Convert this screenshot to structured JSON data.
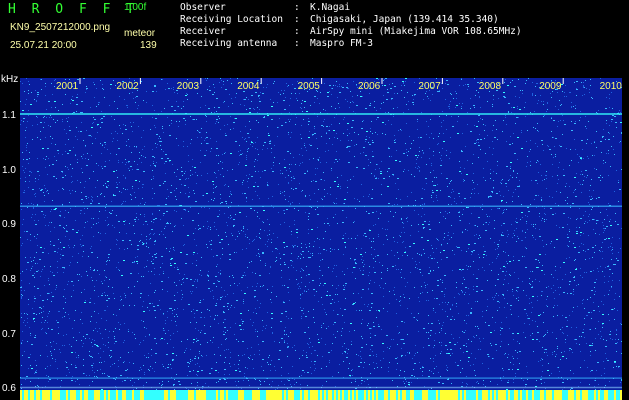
{
  "header": {
    "app_title": "H R O F F T",
    "version": "1.00f",
    "filename": "KN9_2507212000.png",
    "meteor_label": "meteor",
    "datetime": "25.07.21 20:00",
    "count": "139"
  },
  "info": [
    {
      "label": "Observer",
      "sep": ":",
      "value": "K.Nagai"
    },
    {
      "label": "Receiving Location",
      "sep": ":",
      "value": "Chigasaki, Japan (139.414 35.340)"
    },
    {
      "label": "Receiver",
      "sep": ":",
      "value": "AirSpy mini (Miakejima VOR 108.65MHz)"
    },
    {
      "label": "Receiving antenna",
      "sep": ":",
      "value": "Maspro FM-3"
    }
  ],
  "plot": {
    "y_unit": "kHz",
    "y_ticks": [
      "1.1",
      "1.0",
      "0.9",
      "0.8",
      "0.7",
      "0.6"
    ],
    "y_range": [
      0.58,
      1.17
    ],
    "x_ticks": [
      "2001",
      "2002",
      "2003",
      "2004",
      "2005",
      "2006",
      "2007",
      "2008",
      "2009",
      "2010"
    ],
    "colors": {
      "background": "#0a1ea0",
      "noise": "#37b8ff",
      "hot": "#ffff33",
      "cyan": "#33ffff"
    }
  }
}
